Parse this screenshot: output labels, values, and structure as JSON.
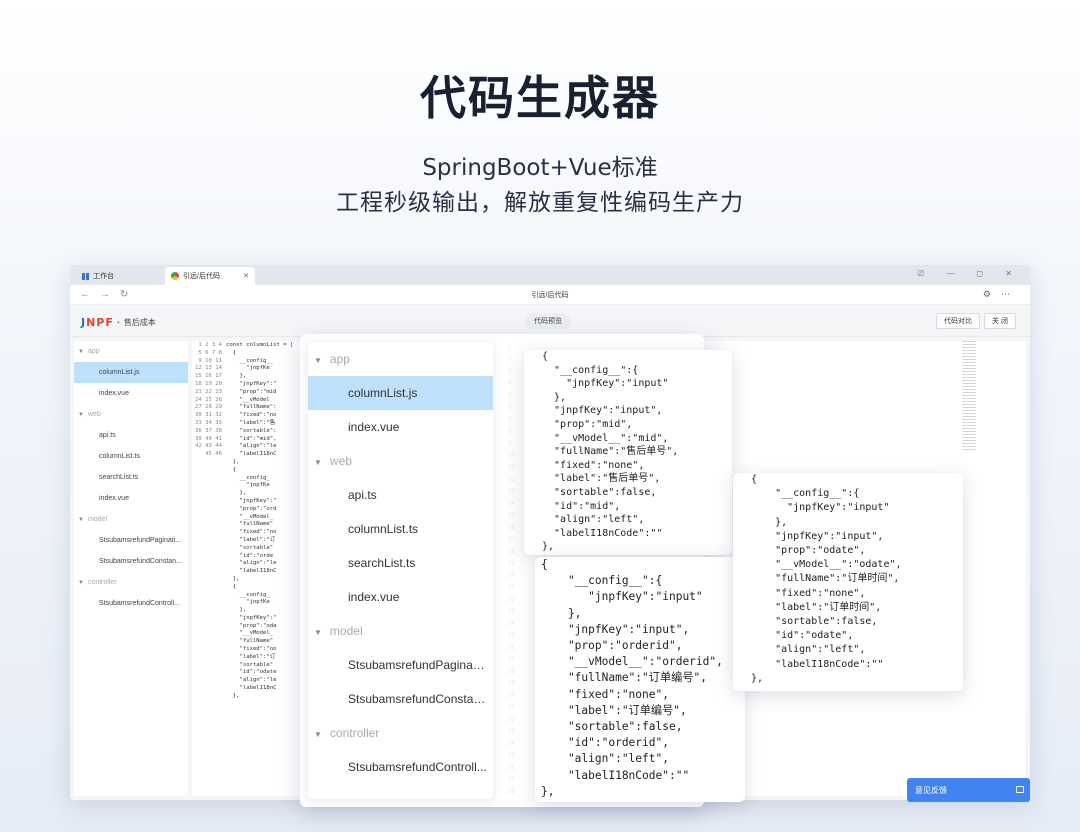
{
  "hero": {
    "title": "代码生成器",
    "subtitle1": "SpringBoot+Vue标准",
    "subtitle2": "工程秒级输出，解放重复性编码生产力"
  },
  "browser": {
    "tabs": [
      {
        "label": "工作台",
        "icon": "grid-icon"
      },
      {
        "label": "引远/后代码",
        "icon": "chrome-icon"
      }
    ],
    "window_controls": "⎚ — ◻ ✕",
    "address_title": "引远/后代码"
  },
  "app_header": {
    "logo_j": "J",
    "logo_rest": "NPF",
    "breadcrumb": "售后成本",
    "preview_button": "代码预览",
    "buttons": [
      "代码对比",
      "关 闭"
    ]
  },
  "left_tree": [
    {
      "type": "folder",
      "label": "app"
    },
    {
      "type": "file",
      "label": "columnList.js",
      "active": true
    },
    {
      "type": "file",
      "label": "index.vue"
    },
    {
      "type": "folder",
      "label": "web"
    },
    {
      "type": "file",
      "label": "api.ts"
    },
    {
      "type": "file",
      "label": "columnList.ts"
    },
    {
      "type": "file",
      "label": "searchList.ts"
    },
    {
      "type": "file",
      "label": "index.vue"
    },
    {
      "type": "folder",
      "label": "model"
    },
    {
      "type": "file",
      "label": "StsubamsrefundPaginati..."
    },
    {
      "type": "file",
      "label": "StsubamsrefundConstan..."
    },
    {
      "type": "folder",
      "label": "controller"
    },
    {
      "type": "file",
      "label": "StsubamsrefundControll..."
    }
  ],
  "code_line_numbers": "1\n2\n3\n4\n5\n6\n7\n8\n9\n10\n11\n12\n13\n14\n15\n16\n17\n18\n19\n20\n21\n22\n23\n24\n25\n26\n27\n28\n29\n30\n31\n32\n33\n34\n35\n36\n37\n38\n39\n40\n41\n42\n43\n44\n45\n46",
  "code_text": "const columnList = [\n  {\n    __config__\n      \"jnpfKe\n    },\n    \"jnpfKey\":\"\n    \"prop\":\"mid\n    \"__vModel\n    \"fullName\":\n    \"fixed\":\"no\n    \"label\":\"售\n    \"sortable\":\n    \"id\":\"mid\",\n    \"align\":\"le\n    \"labelI18nC\n  },\n  {\n    __config_\n      \"jnpfKe\n    },\n    \"jnpfKey\":\"\n    \"prop\":\"ord\n    \"__vModel_\n    \"fullName\"\n    \"fixed\":\"no\n    \"label\":\"订\n    \"sortable\"\n    \"id\":\"orde\n    \"align\":\"le\n    \"labelI18nC\n  },\n  {\n    __config_\n      \"jnpfKe\n    },\n    \"jnpfKey\":\"\n    \"prop\":\"oda\n    \"__vModel_\n    \"fullName\"\n    \"fixed\":\"no\n    \"label\":\"订\n    \"sortable\"\n    \"id\":\"odate\n    \"align\":\"le\n    \"labelI18nC\n  },",
  "overlay_tree": [
    {
      "type": "folder",
      "label": "app"
    },
    {
      "type": "file",
      "label": "columnList.js",
      "active": true
    },
    {
      "type": "file",
      "label": "index.vue"
    },
    {
      "type": "folder",
      "label": "web"
    },
    {
      "type": "file",
      "label": "api.ts"
    },
    {
      "type": "file",
      "label": "columnList.ts"
    },
    {
      "type": "file",
      "label": "searchList.ts"
    },
    {
      "type": "file",
      "label": "index.vue"
    },
    {
      "type": "folder",
      "label": "model"
    },
    {
      "type": "file",
      "label": "StsubamsrefundPaginati..."
    },
    {
      "type": "file",
      "label": "StsubamsrefundConstan..."
    },
    {
      "type": "folder",
      "label": "controller"
    },
    {
      "type": "file",
      "label": "StsubamsrefundControll..."
    }
  ],
  "json_card_1": "{\n  \"__config__\":{\n    \"jnpfKey\":\"input\"\n  },\n  \"jnpfKey\":\"input\",\n  \"prop\":\"mid\",\n  \"__vModel__\":\"mid\",\n  \"fullName\":\"售后单号\",\n  \"fixed\":\"none\",\n  \"label\":\"售后单号\",\n  \"sortable\":false,\n  \"id\":\"mid\",\n  \"align\":\"left\",\n  \"labelI18nCode\":\"\"\n},",
  "json_card_2": "{\n    \"__config__\":{\n       \"jnpfKey\":\"input\"\n    },\n    \"jnpfKey\":\"input\",\n    \"prop\":\"orderid\",\n    \"__vModel__\":\"orderid\",\n    \"fullName\":\"订单编号\",\n    \"fixed\":\"none\",\n    \"label\":\"订单编号\",\n    \"sortable\":false,\n    \"id\":\"orderid\",\n    \"align\":\"left\",\n    \"labelI18nCode\":\"\"\n},",
  "json_card_3": "{\n    \"__config__\":{\n      \"jnpfKey\":\"input\"\n    },\n    \"jnpfKey\":\"input\",\n    \"prop\":\"odate\",\n    \"__vModel__\":\"odate\",\n    \"fullName\":\"订单时间\",\n    \"fixed\":\"none\",\n    \"label\":\"订单时间\",\n    \"sortable\":false,\n    \"id\":\"odate\",\n    \"align\":\"left\",\n    \"labelI18nCode\":\"\"\n},",
  "feedback": {
    "label": "意见反馈",
    "icon": "chat-icon"
  },
  "colors": {
    "accent": "#3f84f0",
    "active_row": "#bfe0fa",
    "logo_blue": "#1f6fe5",
    "logo_red": "#e0452f"
  }
}
